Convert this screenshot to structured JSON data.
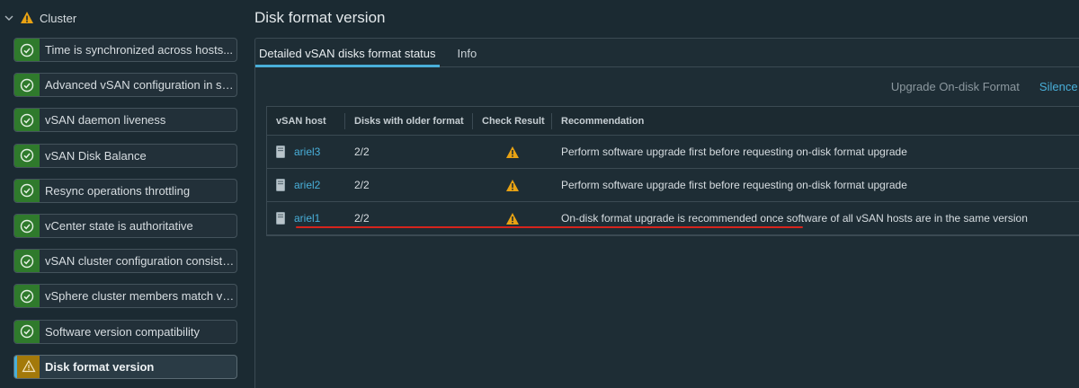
{
  "sidebar": {
    "cluster_label": "Cluster",
    "items": [
      {
        "label": "Time is synchronized across hosts...",
        "status": "ok"
      },
      {
        "label": "Advanced vSAN configuration in sync",
        "status": "ok"
      },
      {
        "label": "vSAN daemon liveness",
        "status": "ok"
      },
      {
        "label": "vSAN Disk Balance",
        "status": "ok"
      },
      {
        "label": "Resync operations throttling",
        "status": "ok"
      },
      {
        "label": "vCenter state is authoritative",
        "status": "ok"
      },
      {
        "label": "vSAN cluster configuration consistency",
        "status": "ok"
      },
      {
        "label": "vSphere cluster members match vSAN",
        "status": "ok"
      },
      {
        "label": "Software version compatibility",
        "status": "ok"
      },
      {
        "label": "Disk format version",
        "status": "warn"
      }
    ]
  },
  "main": {
    "title": "Disk format version",
    "tabs": [
      {
        "label": "Detailed vSAN disks format status",
        "active": true
      },
      {
        "label": "Info",
        "active": false
      }
    ],
    "actions": {
      "upgrade": "Upgrade On-disk Format",
      "silence": "Silence Al"
    },
    "table": {
      "headers": [
        "vSAN host",
        "Disks with older format",
        "Check Result",
        "Recommendation"
      ],
      "rows": [
        {
          "host": "ariel3",
          "disks": "2/2",
          "result": "warning",
          "recommendation": "Perform software upgrade first before requesting on-disk format upgrade"
        },
        {
          "host": "ariel2",
          "disks": "2/2",
          "result": "warning",
          "recommendation": "Perform software upgrade first before requesting on-disk format upgrade"
        },
        {
          "host": "ariel1",
          "disks": "2/2",
          "result": "warning",
          "recommendation": "On-disk format upgrade is recommended once software of all vSAN hosts are in the same version"
        }
      ]
    }
  },
  "colors": {
    "background": "#1b2a32",
    "ok": "#2f7a2c",
    "warn": "#e8a213",
    "link": "#49afd9",
    "underline": "#d6241d"
  }
}
